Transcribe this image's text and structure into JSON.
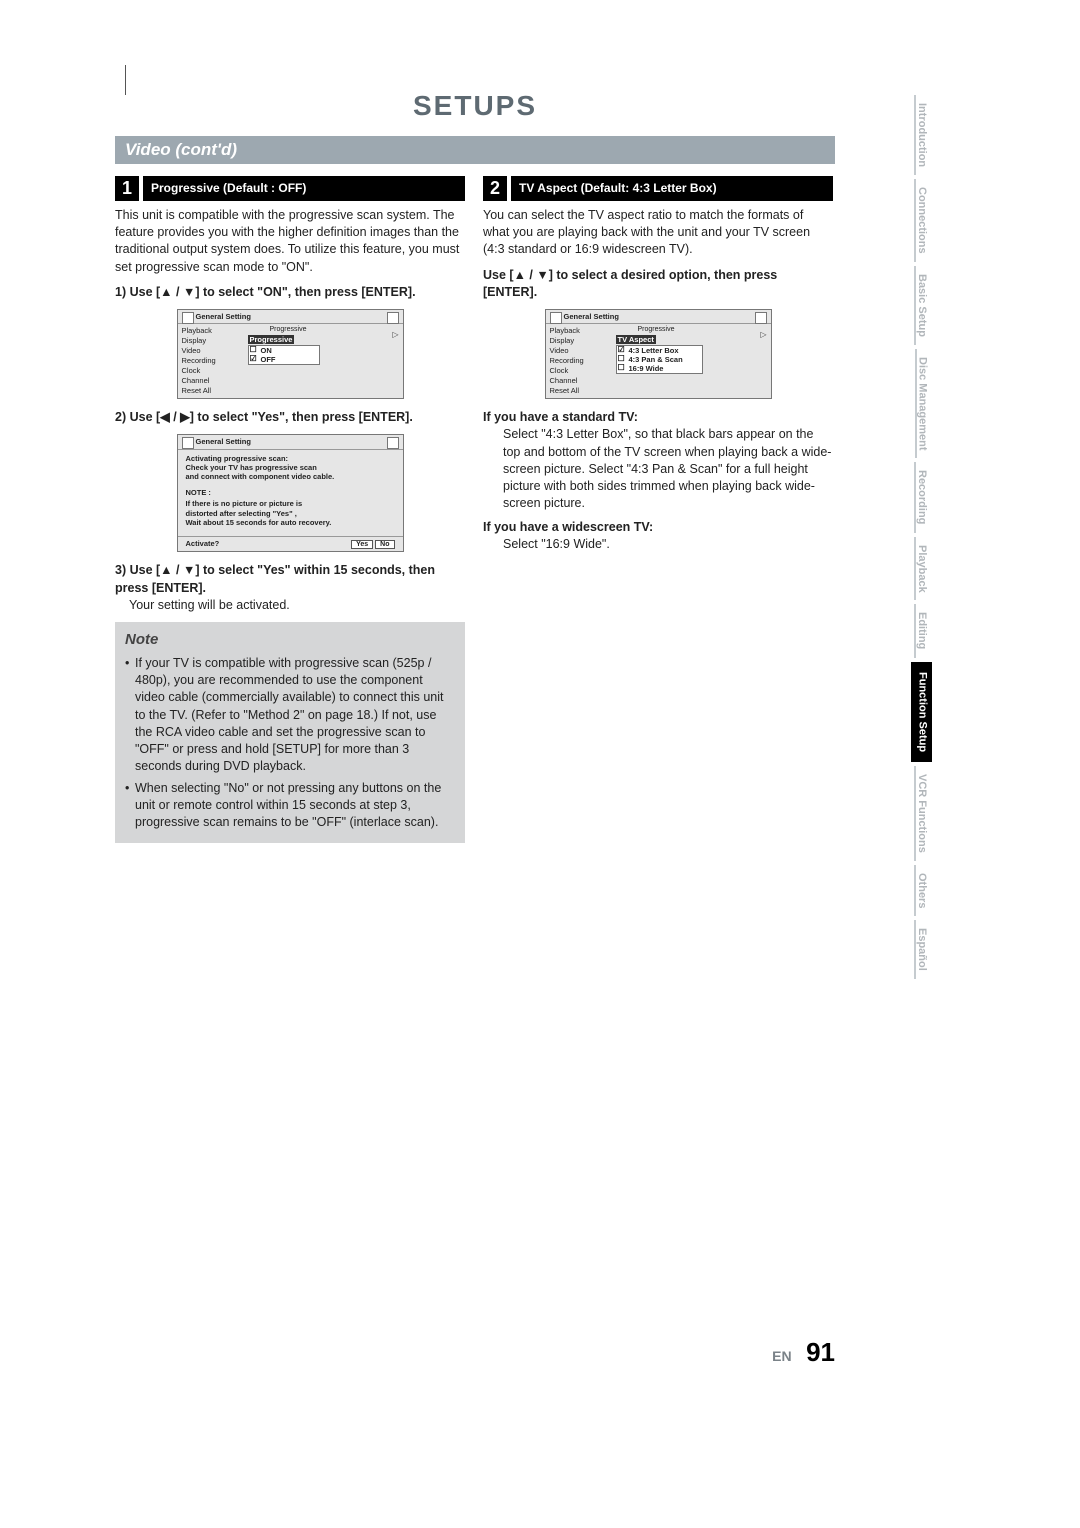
{
  "title": "SETUPS",
  "section": "Video (cont'd)",
  "left": {
    "stepNum": "1",
    "stepLabel": "Progressive (Default : OFF)",
    "intro": "This unit is compatible with the progressive scan system. The feature provides you with the higher definition images than the traditional output system does. To utilize this feature, you must set progressive scan mode to \"ON\".",
    "step1": "1) Use [▲ / ▼] to select \"ON\", then press [ENTER].",
    "osd1": {
      "title": "General Setting",
      "items": [
        "Playback",
        "Display",
        "Video",
        "Recording",
        "Clock",
        "Channel",
        "Reset All"
      ],
      "crumb": "Progressive",
      "highlight": "Progressive",
      "opts": [
        {
          "label": "ON",
          "checked": false
        },
        {
          "label": "OFF",
          "checked": true
        }
      ]
    },
    "step2": "2) Use [◀ / ▶] to select \"Yes\", then press [ENTER].",
    "osd2": {
      "warnHead": "Activating progressive scan:",
      "warn1": "Check your TV has progressive scan",
      "warn2": "and connect with component video cable.",
      "noteHead": "NOTE :",
      "note1": "If there is no picture or picture is",
      "note2": "distorted after selecting    \"Yes\" ,",
      "note3": "Wait about 15 seconds for auto recovery.",
      "activate": "Activate?",
      "yes": "Yes",
      "no": "No"
    },
    "step3a": "3) Use [▲ / ▼] to select \"Yes\" within 15 seconds, then press [ENTER].",
    "step3b": "Your setting will be activated.",
    "noteTitle": "Note",
    "noteBullet1": "If your TV is compatible with progressive scan (525p / 480p), you are recommended to use the component video cable (commercially available) to connect this unit to the TV. (Refer to \"Method 2\" on page 18.) If not, use the RCA video cable and set the progressive scan to \"OFF\" or press and hold [SETUP] for more than 3 seconds during DVD playback.",
    "noteBullet2": "When selecting \"No\" or not pressing any buttons on the unit or remote control within 15 seconds at step 3, progressive scan remains to be \"OFF\" (interlace scan)."
  },
  "right": {
    "stepNum": "2",
    "stepLabel": "TV Aspect (Default: 4:3 Letter Box)",
    "intro": "You can select the TV aspect ratio to match the formats of what you are playing back with the unit and your TV screen (4:3 standard or 16:9 widescreen TV).",
    "useLine": "Use [▲ / ▼] to select a desired option, then press [ENTER].",
    "osd": {
      "title": "General Setting",
      "items": [
        "Playback",
        "Display",
        "Video",
        "Recording",
        "Clock",
        "Channel",
        "Reset All"
      ],
      "crumb": "Progressive",
      "highlight": "TV Aspect",
      "opts": [
        {
          "label": "4:3 Letter Box",
          "checked": true
        },
        {
          "label": "4:3 Pan & Scan",
          "checked": false
        },
        {
          "label": "16:9 Wide",
          "checked": false
        }
      ]
    },
    "stdHead": "If you have a standard TV:",
    "stdBody": "Select \"4:3 Letter Box\", so that black bars appear on the top and bottom of the TV screen when playing back a wide-screen picture. Select \"4:3 Pan & Scan\" for a full height picture with both sides trimmed when playing back wide-screen picture.",
    "wideHead": "If you have a widescreen TV:",
    "wideBody": "Select \"16:9 Wide\"."
  },
  "tabs": [
    "Introduction",
    "Connections",
    "Basic Setup",
    "Disc\nManagement",
    "Recording",
    "Playback",
    "Editing",
    "Function\nSetup",
    "VCR Functions",
    "Others",
    "Español"
  ],
  "activeTab": 7,
  "footerLang": "EN",
  "footerPage": "91"
}
